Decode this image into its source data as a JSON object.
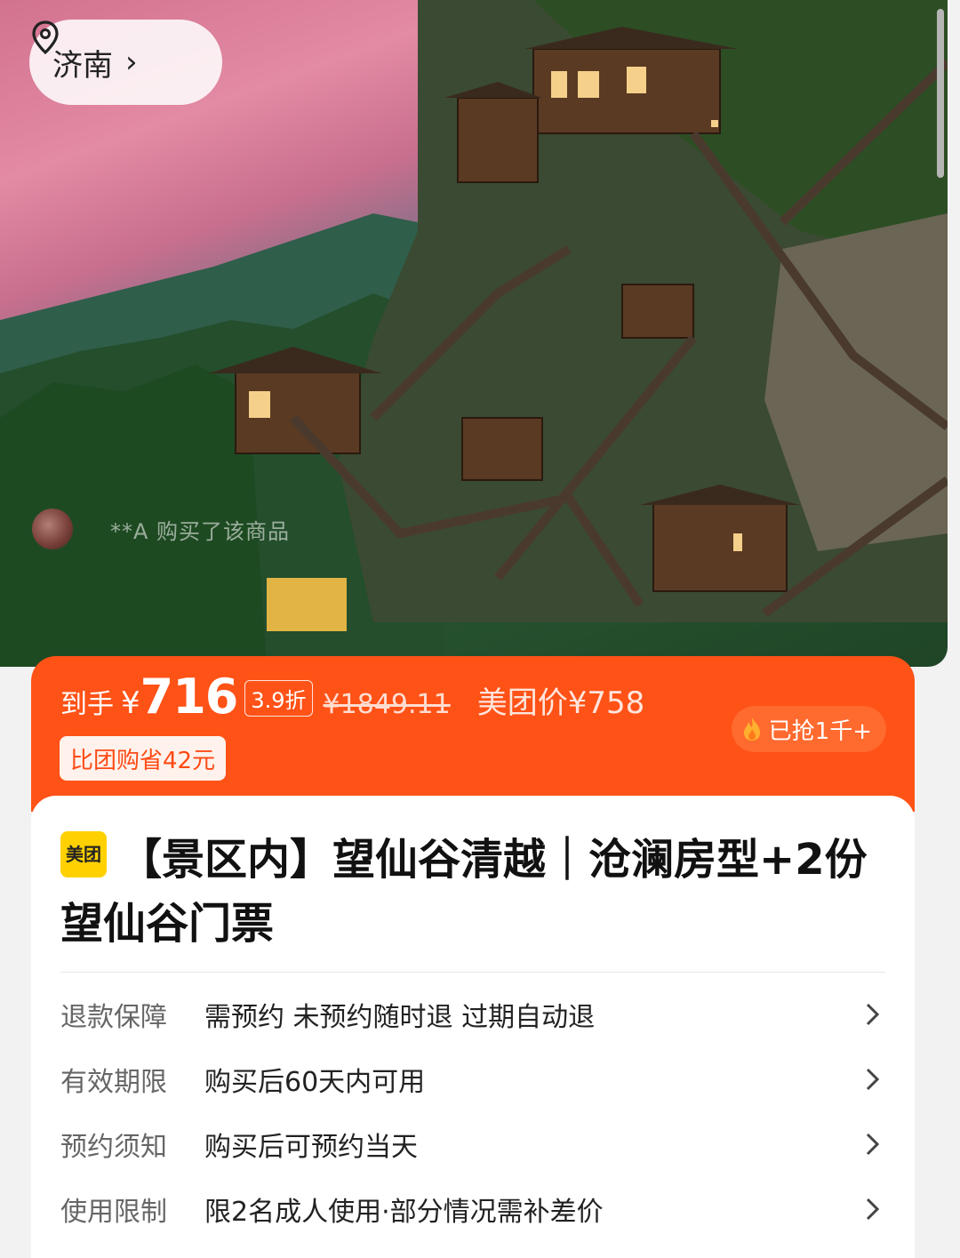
{
  "location": {
    "city": "济南",
    "chevron": "›"
  },
  "hero": {
    "buyer_text": "**A 购买了该商品"
  },
  "price": {
    "label": "到手",
    "yen": "¥",
    "amount": "716",
    "discount": "3.9折",
    "original": "¥1849.11",
    "meituan_price": "美团价¥758",
    "save_text": "比团购省42元",
    "grabbed": "已抢1千+"
  },
  "product": {
    "logo": "美团",
    "title": "【景区内】望仙谷清越｜沧澜房型+2份望仙谷门票"
  },
  "details": [
    {
      "key": "退款保障",
      "value": "需预约 未预约随时退 过期自动退"
    },
    {
      "key": "有效期限",
      "value": "购买后60天内可用"
    },
    {
      "key": "预约须知",
      "value": "购买后可预约当天"
    },
    {
      "key": "使用限制",
      "value": "限2名成人使用·部分情况需补差价"
    }
  ],
  "colors": {
    "accent": "#ff5217",
    "logo_yellow": "#ffd100"
  },
  "icons": [
    "location-pin-icon",
    "chevron-right-icon",
    "fire-icon"
  ]
}
